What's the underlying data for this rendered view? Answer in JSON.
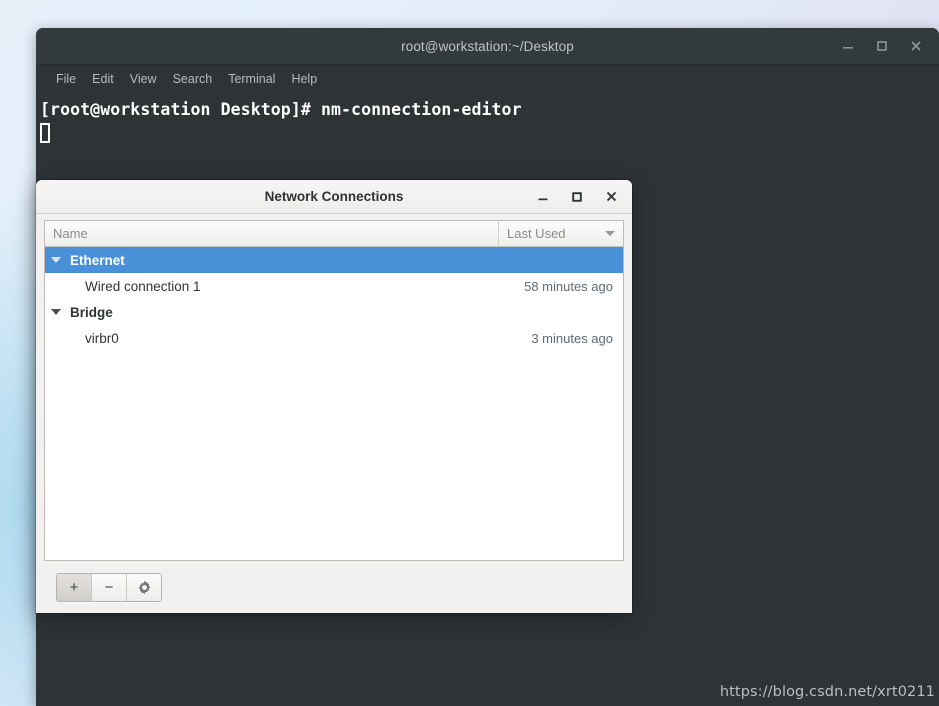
{
  "desktop": {
    "watermark": "https://blog.csdn.net/xrt0211"
  },
  "terminal": {
    "title": "root@workstation:~/Desktop",
    "menu": [
      {
        "label": "File"
      },
      {
        "label": "Edit"
      },
      {
        "label": "View"
      },
      {
        "label": "Search"
      },
      {
        "label": "Terminal"
      },
      {
        "label": "Help"
      }
    ],
    "prompt_line": "[root@workstation Desktop]# nm-connection-editor",
    "controls": [
      {
        "name": "minimize",
        "glyph": "minimize-icon"
      },
      {
        "name": "maximize",
        "glyph": "maximize-icon"
      },
      {
        "name": "close",
        "glyph": "close-icon"
      }
    ]
  },
  "dialog": {
    "title": "Network Connections",
    "controls": [
      {
        "name": "minimize",
        "glyph": "minimize-icon"
      },
      {
        "name": "maximize",
        "glyph": "maximize-icon"
      },
      {
        "name": "close",
        "glyph": "close-icon"
      }
    ],
    "columns": {
      "name": "Name",
      "last_used": "Last Used",
      "sort_direction": "descending"
    },
    "rows": [
      {
        "type": "group",
        "label": "Ethernet",
        "selected": true,
        "expanded": true,
        "last_used": ""
      },
      {
        "type": "connection",
        "label": "Wired connection 1",
        "selected": false,
        "last_used": "58 minutes ago"
      },
      {
        "type": "group",
        "label": "Bridge",
        "selected": false,
        "expanded": true,
        "last_used": ""
      },
      {
        "type": "connection",
        "label": "virbr0",
        "selected": false,
        "last_used": "3 minutes ago"
      }
    ],
    "toolbar": [
      {
        "name": "add-connection",
        "label": "+",
        "icon": "plus-icon",
        "active": true
      },
      {
        "name": "remove-connection",
        "label": "−",
        "icon": "minus-icon",
        "active": false
      },
      {
        "name": "edit-connection",
        "label": "",
        "icon": "gear-icon",
        "active": false
      }
    ]
  },
  "colors": {
    "selection_blue": "#4a90d9",
    "terminal_bg": "#2e3436",
    "dialog_bg": "#f2f1f0",
    "last_used_text": "#5b6a78"
  }
}
